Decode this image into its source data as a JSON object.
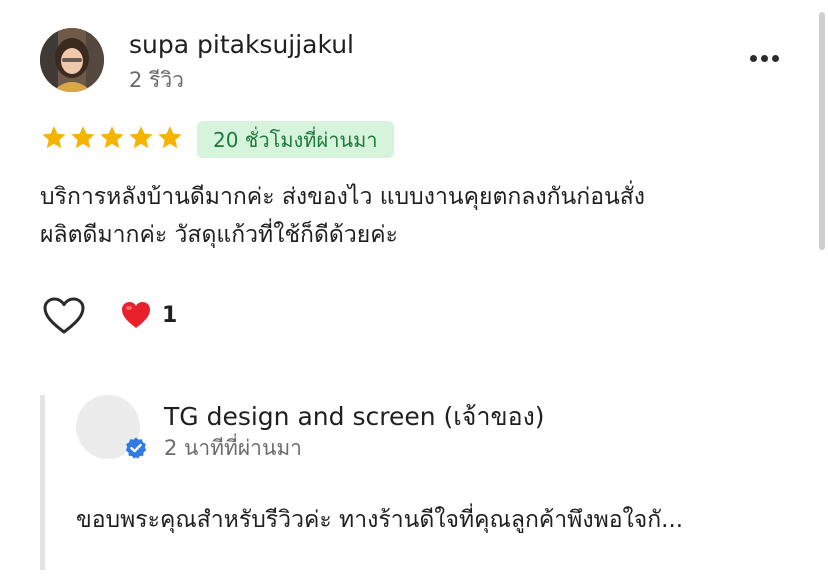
{
  "review": {
    "reviewer_name": "supa pitaksujjakul",
    "reviewer_review_count": "2 รีวิว",
    "rating": 5,
    "rating_max": 5,
    "star_color": "#f5b400",
    "time_ago": "20 ชั่วโมงที่ผ่านมา",
    "text_lines": [
      "บริการหลังบ้านดีมากค่ะ ส่งของไว แบบงานคุยตกลงกันก่อนสั่ง",
      "ผลิตดีมากค่ะ วัสดุแก้วที่ใช้ก็ดีด้วยค่ะ"
    ],
    "reaction_count": "1",
    "reaction_icon": "red-heart-icon",
    "like_icon": "heart-outline-icon",
    "more_icon": "more-horizontal-icon"
  },
  "owner_reply": {
    "name": "TG design and screen (เจ้าของ)",
    "time_ago": "2 นาทีที่ผ่านมา",
    "text": "ขอบพระคุณสำหรับรีวิวค่ะ ทางร้านดีใจที่คุณลูกค้าพึงพอใจกั...",
    "verified_icon": "verified-check-icon",
    "verified_color": "#2f7ae5"
  }
}
